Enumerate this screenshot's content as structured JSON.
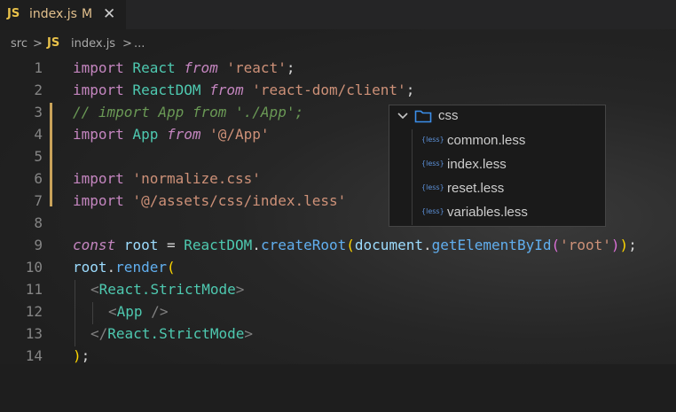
{
  "tab": {
    "badge": "JS",
    "title": "index.js",
    "modified": "M",
    "close": "✕"
  },
  "breadcrumb": {
    "folder": "src",
    "sep1": ">",
    "badge": "JS",
    "file": "index.js",
    "sep2": ">",
    "ellipsis": "..."
  },
  "line_numbers": [
    "1",
    "2",
    "3",
    "4",
    "5",
    "6",
    "7",
    "8",
    "9",
    "10",
    "11",
    "12",
    "13",
    "14"
  ],
  "code": {
    "l1": {
      "a": "import",
      "b": " React ",
      "c": "from",
      "d": " 'react'",
      "e": ";"
    },
    "l2": {
      "a": "import",
      "b": " ReactDOM ",
      "c": "from",
      "d": " 'react-dom/client'",
      "e": ";"
    },
    "l3": {
      "a": "// import App from './App';"
    },
    "l4": {
      "a": "import",
      "b": " App ",
      "c": "from",
      "d": " '@/App'"
    },
    "l6": {
      "a": "import",
      "d": " 'normalize.css'"
    },
    "l7": {
      "a": "import",
      "d": " '@/assets/css/index.less'"
    },
    "l9": {
      "a": "const",
      "b": " root ",
      "c": "= ",
      "d": "ReactDOM",
      "e": ".",
      "f": "createRoot",
      "g": "(",
      "h": "document",
      "i": ".",
      "j": "getElementById",
      "k": "(",
      "l": "'root'",
      "m": ")",
      "n": ")",
      "o": ";"
    },
    "l10": {
      "a": "root",
      "b": ".",
      "c": "render",
      "d": "("
    },
    "l11": {
      "a": "<",
      "b": "React.StrictMode",
      "c": ">"
    },
    "l12": {
      "a": "<",
      "b": "App",
      "c": " />"
    },
    "l13": {
      "a": "</",
      "b": "React.StrictMode",
      "c": ">"
    },
    "l14": {
      "a": ")",
      "b": ";"
    }
  },
  "popup": {
    "folder_chevron": "⌄",
    "folder_name": "css",
    "badge": "{less}",
    "files": [
      "common.less",
      "index.less",
      "reset.less",
      "variables.less"
    ]
  },
  "colors": {
    "editor_bg": "#1e1e1e",
    "keyword": "#c586c0",
    "identifier": "#4ec9b0",
    "string": "#ce9178",
    "comment": "#6a9955",
    "modified": "#e2c08d"
  }
}
